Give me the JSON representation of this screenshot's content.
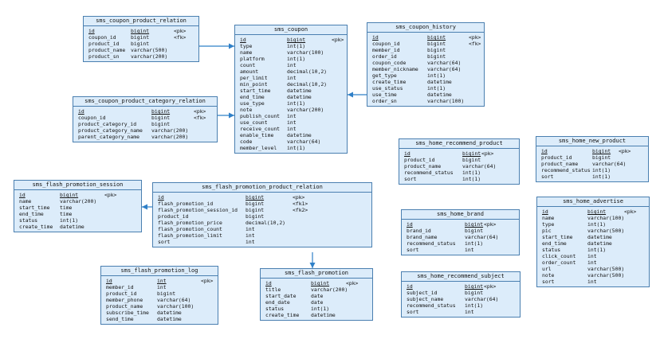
{
  "colors": {
    "fill": "#dcecfa",
    "border": "#4a7fb0",
    "link": "#2f80c8"
  },
  "entities": [
    {
      "id": "sms_coupon_product_relation",
      "title": "sms_coupon_product_relation",
      "columns": [
        {
          "name": "id",
          "type": "bigint",
          "key": "<pk>"
        },
        {
          "name": "coupon_id",
          "type": "bigint",
          "key": "<fk>"
        },
        {
          "name": "product_id",
          "type": "bigint",
          "key": ""
        },
        {
          "name": "product_name",
          "type": "varchar(500)",
          "key": ""
        },
        {
          "name": "product_sn",
          "type": "varchar(200)",
          "key": ""
        }
      ]
    },
    {
      "id": "sms_coupon",
      "title": "sms_coupon",
      "columns": [
        {
          "name": "id",
          "type": "bigint",
          "key": "<pk>"
        },
        {
          "name": "type",
          "type": "int(1)",
          "key": ""
        },
        {
          "name": "name",
          "type": "varchar(100)",
          "key": ""
        },
        {
          "name": "platform",
          "type": "int(1)",
          "key": ""
        },
        {
          "name": "count",
          "type": "int",
          "key": ""
        },
        {
          "name": "amount",
          "type": "decimal(10,2)",
          "key": ""
        },
        {
          "name": "per_limit",
          "type": "int",
          "key": ""
        },
        {
          "name": "min_point",
          "type": "decimal(10,2)",
          "key": ""
        },
        {
          "name": "start_time",
          "type": "datetime",
          "key": ""
        },
        {
          "name": "end_time",
          "type": "datetime",
          "key": ""
        },
        {
          "name": "use_type",
          "type": "int(1)",
          "key": ""
        },
        {
          "name": "note",
          "type": "varchar(200)",
          "key": ""
        },
        {
          "name": "publish_count",
          "type": "int",
          "key": ""
        },
        {
          "name": "use_count",
          "type": "int",
          "key": ""
        },
        {
          "name": "receive_count",
          "type": "int",
          "key": ""
        },
        {
          "name": "enable_time",
          "type": "datetime",
          "key": ""
        },
        {
          "name": "code",
          "type": "varchar(64)",
          "key": ""
        },
        {
          "name": "member_level",
          "type": "int(1)",
          "key": ""
        }
      ]
    },
    {
      "id": "sms_coupon_history",
      "title": "sms_coupon_history",
      "columns": [
        {
          "name": "id",
          "type": "bigint",
          "key": "<pk>"
        },
        {
          "name": "coupon_id",
          "type": "bigint",
          "key": "<fk>"
        },
        {
          "name": "member_id",
          "type": "bigint",
          "key": ""
        },
        {
          "name": "order_id",
          "type": "bigint",
          "key": ""
        },
        {
          "name": "coupon_code",
          "type": "varchar(64)",
          "key": ""
        },
        {
          "name": "member_nickname",
          "type": "varchar(64)",
          "key": ""
        },
        {
          "name": "get_type",
          "type": "int(1)",
          "key": ""
        },
        {
          "name": "create_time",
          "type": "datetime",
          "key": ""
        },
        {
          "name": "use_status",
          "type": "int(1)",
          "key": ""
        },
        {
          "name": "use_time",
          "type": "datetime",
          "key": ""
        },
        {
          "name": "order_sn",
          "type": "varchar(100)",
          "key": ""
        }
      ]
    },
    {
      "id": "sms_coupon_product_category_relation",
      "title": "sms_coupon_product_category_relation",
      "columns": [
        {
          "name": "id",
          "type": "bigint",
          "key": "<pk>"
        },
        {
          "name": "coupon_id",
          "type": "bigint",
          "key": "<fk>"
        },
        {
          "name": "product_category_id",
          "type": "bigint",
          "key": ""
        },
        {
          "name": "product_category_name",
          "type": "varchar(200)",
          "key": ""
        },
        {
          "name": "parent_category_name",
          "type": "varchar(200)",
          "key": ""
        }
      ]
    },
    {
      "id": "sms_home_recommend_product",
      "title": "sms_home_recommend_product",
      "columns": [
        {
          "name": "id",
          "type": "bigint",
          "key": "<pk>"
        },
        {
          "name": "product_id",
          "type": "bigint",
          "key": ""
        },
        {
          "name": "product_name",
          "type": "varchar(64)",
          "key": ""
        },
        {
          "name": "recommend_status",
          "type": "int(1)",
          "key": ""
        },
        {
          "name": "sort",
          "type": "int(1)",
          "key": ""
        }
      ]
    },
    {
      "id": "sms_home_new_product",
      "title": "sms_home_new_product",
      "columns": [
        {
          "name": "id",
          "type": "bigint",
          "key": "<pk>"
        },
        {
          "name": "product_id",
          "type": "bigint",
          "key": ""
        },
        {
          "name": "product_name",
          "type": "varchar(64)",
          "key": ""
        },
        {
          "name": "recommend_status",
          "type": "int(1)",
          "key": ""
        },
        {
          "name": "sort",
          "type": "int(1)",
          "key": ""
        }
      ]
    },
    {
      "id": "sms_flash_promotion_session",
      "title": "sms_flash_promotion_session",
      "columns": [
        {
          "name": "id",
          "type": "bigint",
          "key": "<pk>"
        },
        {
          "name": "name",
          "type": "varchar(200)",
          "key": ""
        },
        {
          "name": "start_time",
          "type": "time",
          "key": ""
        },
        {
          "name": "end_time",
          "type": "time",
          "key": ""
        },
        {
          "name": "status",
          "type": "int(1)",
          "key": ""
        },
        {
          "name": "create_time",
          "type": "datetime",
          "key": ""
        }
      ]
    },
    {
      "id": "sms_flash_promotion_product_relation",
      "title": "sms_flash_promotion_product_relation",
      "columns": [
        {
          "name": "id",
          "type": "bigint",
          "key": "<pk>"
        },
        {
          "name": "flash_promotion_id",
          "type": "bigint",
          "key": "<fk1>"
        },
        {
          "name": "flash_promotion_session_id",
          "type": "bigint",
          "key": "<fk2>"
        },
        {
          "name": "product_id",
          "type": "bigint",
          "key": ""
        },
        {
          "name": "flash_promotion_price",
          "type": "decimal(10,2)",
          "key": ""
        },
        {
          "name": "flash_promotion_count",
          "type": "int",
          "key": ""
        },
        {
          "name": "flash_promotion_limit",
          "type": "int",
          "key": ""
        },
        {
          "name": "sort",
          "type": "int",
          "key": ""
        }
      ]
    },
    {
      "id": "sms_home_brand",
      "title": "sms_home_brand",
      "columns": [
        {
          "name": "id",
          "type": "bigint",
          "key": "<pk>"
        },
        {
          "name": "brand_id",
          "type": "bigint",
          "key": ""
        },
        {
          "name": "brand_name",
          "type": "varchar(64)",
          "key": ""
        },
        {
          "name": "recommend_status",
          "type": "int(1)",
          "key": ""
        },
        {
          "name": "sort",
          "type": "int",
          "key": ""
        }
      ]
    },
    {
      "id": "sms_home_advertise",
      "title": "sms_home_advertise",
      "columns": [
        {
          "name": "id",
          "type": "bigint",
          "key": "<pk>"
        },
        {
          "name": "name",
          "type": "varchar(100)",
          "key": ""
        },
        {
          "name": "type",
          "type": "int(1)",
          "key": ""
        },
        {
          "name": "pic",
          "type": "varchar(500)",
          "key": ""
        },
        {
          "name": "start_time",
          "type": "datetime",
          "key": ""
        },
        {
          "name": "end_time",
          "type": "datetime",
          "key": ""
        },
        {
          "name": "status",
          "type": "int(1)",
          "key": ""
        },
        {
          "name": "click_count",
          "type": "int",
          "key": ""
        },
        {
          "name": "order_count",
          "type": "int",
          "key": ""
        },
        {
          "name": "url",
          "type": "varchar(500)",
          "key": ""
        },
        {
          "name": "note",
          "type": "varchar(500)",
          "key": ""
        },
        {
          "name": "sort",
          "type": "int",
          "key": ""
        }
      ]
    },
    {
      "id": "sms_flash_promotion_log",
      "title": "sms_flash_promotion_log",
      "columns": [
        {
          "name": "id",
          "type": "int",
          "key": "<pk>"
        },
        {
          "name": "member_id",
          "type": "int",
          "key": ""
        },
        {
          "name": "product_id",
          "type": "bigint",
          "key": ""
        },
        {
          "name": "member_phone",
          "type": "varchar(64)",
          "key": ""
        },
        {
          "name": "product_name",
          "type": "varchar(100)",
          "key": ""
        },
        {
          "name": "subscribe_time",
          "type": "datetime",
          "key": ""
        },
        {
          "name": "send_time",
          "type": "datetime",
          "key": ""
        }
      ]
    },
    {
      "id": "sms_flash_promotion",
      "title": "sms_flash_promotion",
      "columns": [
        {
          "name": "id",
          "type": "bigint",
          "key": "<pk>"
        },
        {
          "name": "title",
          "type": "varchar(200)",
          "key": ""
        },
        {
          "name": "start_date",
          "type": "date",
          "key": ""
        },
        {
          "name": "end_date",
          "type": "date",
          "key": ""
        },
        {
          "name": "status",
          "type": "int(1)",
          "key": ""
        },
        {
          "name": "create_time",
          "type": "datetime",
          "key": ""
        }
      ]
    },
    {
      "id": "sms_home_recommend_subject",
      "title": "sms_home_recommend_subject",
      "columns": [
        {
          "name": "id",
          "type": "bigint",
          "key": "<pk>"
        },
        {
          "name": "subject_id",
          "type": "bigint",
          "key": ""
        },
        {
          "name": "subject_name",
          "type": "varchar(64)",
          "key": ""
        },
        {
          "name": "recommend_status",
          "type": "int(1)",
          "key": ""
        },
        {
          "name": "sort",
          "type": "int",
          "key": ""
        }
      ]
    }
  ],
  "relations": [
    {
      "from": "sms_coupon_product_relation",
      "to": "sms_coupon"
    },
    {
      "from": "sms_coupon_history",
      "to": "sms_coupon"
    },
    {
      "from": "sms_coupon_product_category_relation",
      "to": "sms_coupon"
    },
    {
      "from": "sms_flash_promotion_product_relation",
      "to": "sms_flash_promotion_session"
    },
    {
      "from": "sms_flash_promotion_product_relation",
      "to": "sms_flash_promotion"
    }
  ]
}
